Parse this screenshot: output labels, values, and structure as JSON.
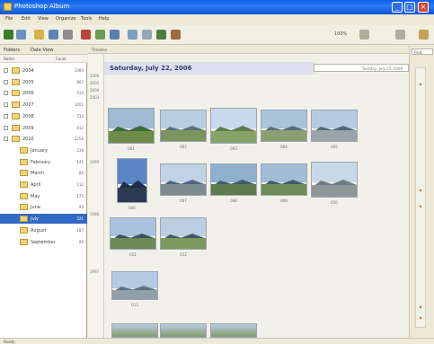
{
  "window": {
    "title": "Photoshop Album"
  },
  "menu": [
    "File",
    "Edit",
    "View",
    "Organize",
    "Tools",
    "Help"
  ],
  "toolbar": {
    "zoom_text": "100%"
  },
  "left_panel": {
    "header_left": "Folders",
    "header_mid": "Date View",
    "col_name": "Name",
    "col_count": "Count",
    "tree": [
      {
        "label": "2004",
        "count": "1304"
      },
      {
        "label": "2005",
        "count": "865"
      },
      {
        "label": "2006",
        "count": "514"
      },
      {
        "label": "2007",
        "count": "1201"
      },
      {
        "label": "2008",
        "count": "733"
      },
      {
        "label": "2009",
        "count": "412"
      },
      {
        "label": "2010",
        "count": "2256"
      },
      {
        "label": "January",
        "count": "238"
      },
      {
        "label": "February",
        "count": "141"
      },
      {
        "label": "March",
        "count": "86"
      },
      {
        "label": "April",
        "count": "112"
      },
      {
        "label": "May",
        "count": "175"
      },
      {
        "label": "June",
        "count": "94"
      },
      {
        "label": "July",
        "count": "321"
      },
      {
        "label": "August",
        "count": "187"
      },
      {
        "label": "September",
        "count": "96"
      }
    ]
  },
  "address": {
    "text": "Timeline"
  },
  "main": {
    "date_header": "Saturday, July 22, 2006",
    "timeline_labels": [
      "2006",
      "2005",
      "2004",
      "2003",
      "1999",
      "1998",
      "1997"
    ],
    "captions": [
      "001",
      "002",
      "003",
      "004",
      "005",
      "006",
      "007",
      "008",
      "009",
      "010",
      "011",
      "012",
      "013"
    ]
  },
  "right_panel": {
    "date_box": "Tuesday, July 25, 2006",
    "top_label": "Find"
  },
  "status": {
    "text": "Ready"
  },
  "colors": {
    "accent": "#316ac5",
    "title_bar": "#0a5ee8",
    "date_header": "#dedfee"
  }
}
